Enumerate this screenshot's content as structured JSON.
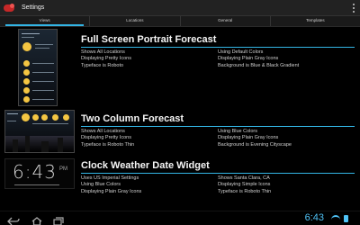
{
  "app": {
    "title": "Settings"
  },
  "tabs": [
    {
      "label": "Views",
      "active": true
    },
    {
      "label": "Locations",
      "active": false
    },
    {
      "label": "General",
      "active": false
    },
    {
      "label": "Templates",
      "active": false
    }
  ],
  "widgets": [
    {
      "title": "Full Screen Portrait Forecast",
      "left": [
        "Shows All Locations",
        "Displaying Pretty Icons",
        "Typeface is Roboto"
      ],
      "right": [
        "Using Default Colors",
        "Displaying Plain Gray Icons",
        "Background is Blue & Black Gradient"
      ]
    },
    {
      "title": "Two Column Forecast",
      "left": [
        "Shows All Locations",
        "Displaying Pretty Icons",
        "Typeface is Roboto Thin"
      ],
      "right": [
        "Using Blue Colors",
        "Displaying Plain Gray Icons",
        "Background is Evening Cityscape"
      ]
    },
    {
      "title": "Clock Weather Date Widget",
      "left": [
        "Uses US Imperial Settings",
        "Using Blue Colors",
        "Displaying Plain Gray Icons"
      ],
      "right": [
        "Shows Santa Clara, CA",
        "Displaying Simple Icons",
        "Typeface is Roboto Thin"
      ]
    }
  ],
  "clock_preview": {
    "time": "6:43",
    "ampm": "PM"
  },
  "status_bar": {
    "time": "6:43"
  },
  "colors": {
    "accent": "#33b5e5",
    "status": "#4fc3f7",
    "app_icon": "#c62828"
  },
  "icons": {
    "app": "cloud-icon",
    "overflow": "overflow-menu-icon",
    "back": "back-icon",
    "home": "home-icon",
    "recent": "recent-apps-icon",
    "wifi": "wifi-icon",
    "battery": "battery-icon"
  }
}
